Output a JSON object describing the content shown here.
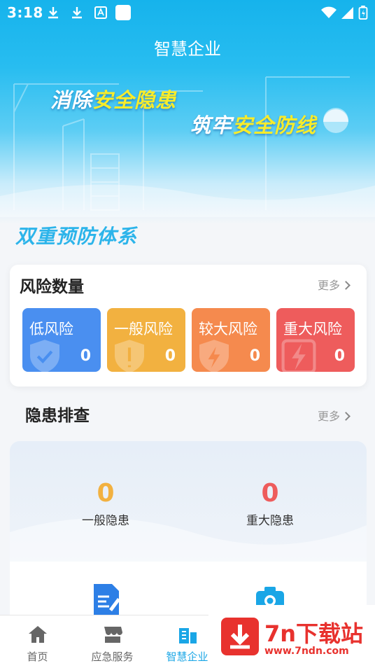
{
  "status_bar": {
    "time": "3:18"
  },
  "header": {
    "title": "智慧企业"
  },
  "banner": {
    "line1_a": "消除",
    "line1_b": "安全隐患",
    "line2_a": "筑牢",
    "line2_b": "安全防线"
  },
  "section_title": "双重预防体系",
  "risk_card": {
    "title": "风险数量",
    "more": "更多",
    "items": [
      {
        "label": "低风险",
        "value": "0",
        "color": "#4a8ff0"
      },
      {
        "label": "一般风险",
        "value": "0",
        "color": "#f2b140"
      },
      {
        "label": "较大风险",
        "value": "0",
        "color": "#f58a4e"
      },
      {
        "label": "重大风险",
        "value": "0",
        "color": "#ee5c5c"
      }
    ]
  },
  "hazard": {
    "title": "隐患排查",
    "more": "更多",
    "stats": [
      {
        "value": "0",
        "label": "一般隐患",
        "color": "#f2b140"
      },
      {
        "value": "0",
        "label": "重大隐患",
        "color": "#ee5c5c"
      }
    ]
  },
  "tabbar": {
    "tabs": [
      {
        "label": "首页",
        "icon": "home-icon"
      },
      {
        "label": "应急服务",
        "icon": "store-icon"
      },
      {
        "label": "智慧企业",
        "icon": "building-icon",
        "active": true
      }
    ]
  },
  "watermark": {
    "brand": "7n下载站",
    "url": "www.7ndn.com"
  }
}
